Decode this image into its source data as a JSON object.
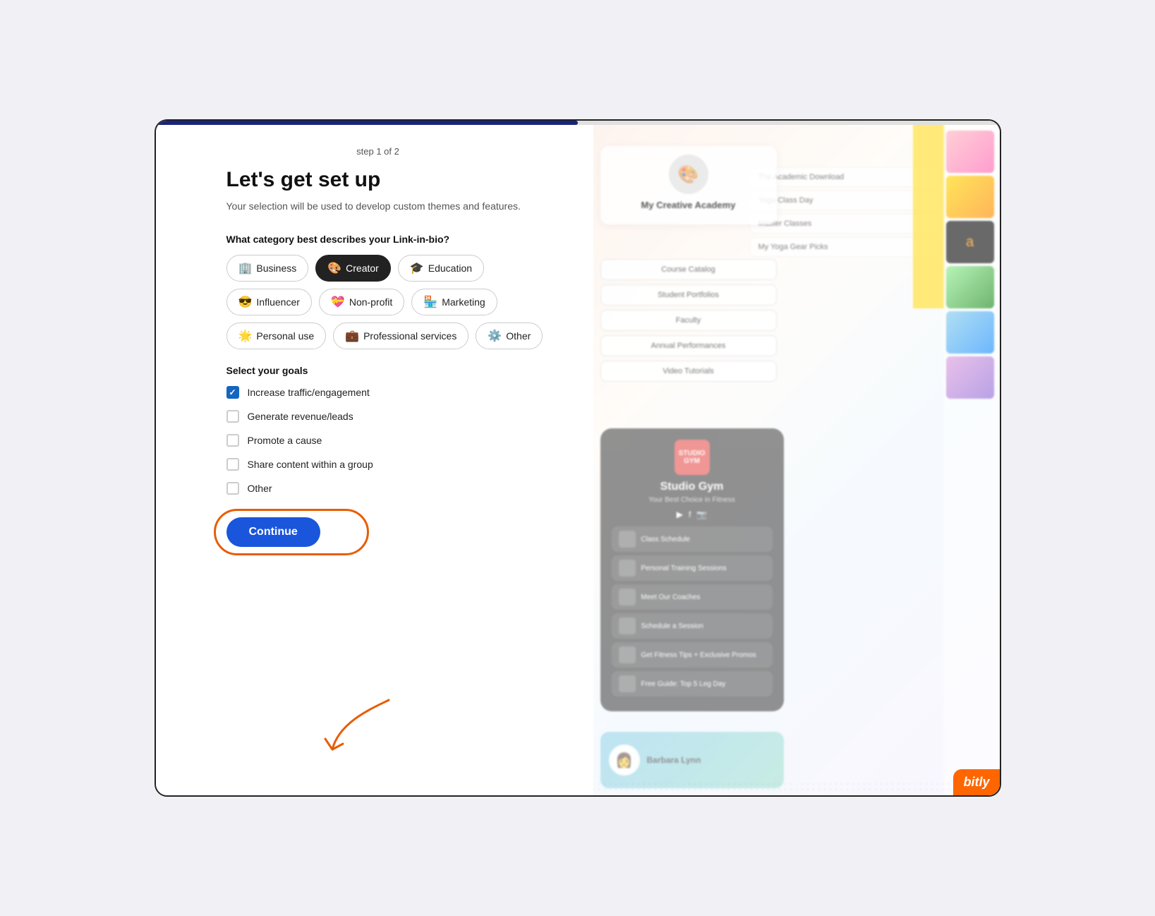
{
  "progress": {
    "step_label": "step 1 of 2",
    "fill_percent": 50
  },
  "form": {
    "title": "Let's get set up",
    "subtitle": "Your selection will be used to develop custom themes and features.",
    "category_section_label": "What category best describes your Link-in-bio?",
    "categories": [
      {
        "id": "business",
        "label": "Business",
        "emoji": "🏢",
        "active": false
      },
      {
        "id": "creator",
        "label": "Creator",
        "emoji": "🎨",
        "active": true
      },
      {
        "id": "education",
        "label": "Education",
        "emoji": "🎓",
        "active": false
      },
      {
        "id": "influencer",
        "label": "Influencer",
        "emoji": "😎",
        "active": false
      },
      {
        "id": "nonprofit",
        "label": "Non-profit",
        "emoji": "💝",
        "active": false
      },
      {
        "id": "marketing",
        "label": "Marketing",
        "emoji": "🏪",
        "active": false
      },
      {
        "id": "personal",
        "label": "Personal use",
        "emoji": "🌟",
        "active": false
      },
      {
        "id": "professional",
        "label": "Professional services",
        "emoji": "💼",
        "active": false
      },
      {
        "id": "other",
        "label": "Other",
        "emoji": "⚙️",
        "active": false
      }
    ],
    "goals_section_label": "Select your goals",
    "goals": [
      {
        "id": "traffic",
        "label": "Increase traffic/engagement",
        "checked": true
      },
      {
        "id": "revenue",
        "label": "Generate revenue/leads",
        "checked": false
      },
      {
        "id": "cause",
        "label": "Promote a cause",
        "checked": false
      },
      {
        "id": "share",
        "label": "Share content within a group",
        "checked": false
      },
      {
        "id": "other_goal",
        "label": "Other",
        "checked": false
      }
    ],
    "continue_button_label": "Continue"
  },
  "preview": {
    "edu_title": "My Creative Academy",
    "gym_name": "Studio Gym",
    "gym_subtitle": "Your Best Choice in Fitness",
    "barbara_name": "Barbara Lynn",
    "links": {
      "edu": [
        "Course Catalog",
        "Student Portfolios",
        "Faculty",
        "Annual Performances",
        "Video Tutorials"
      ],
      "gym": [
        "Class Schedule",
        "Personal Training Sessions",
        "Meet Our Coaches",
        "Schedule a Session",
        "Get Fitness Tips + Exclusive Promos",
        "Free Guide: Top 5 Leg Day"
      ]
    },
    "top_links": [
      "The Academic Download",
      "Yoga Class Day",
      "Master Classes",
      "My Yoga Gear Picks"
    ]
  },
  "branding": {
    "bitly_label": "bitly"
  }
}
